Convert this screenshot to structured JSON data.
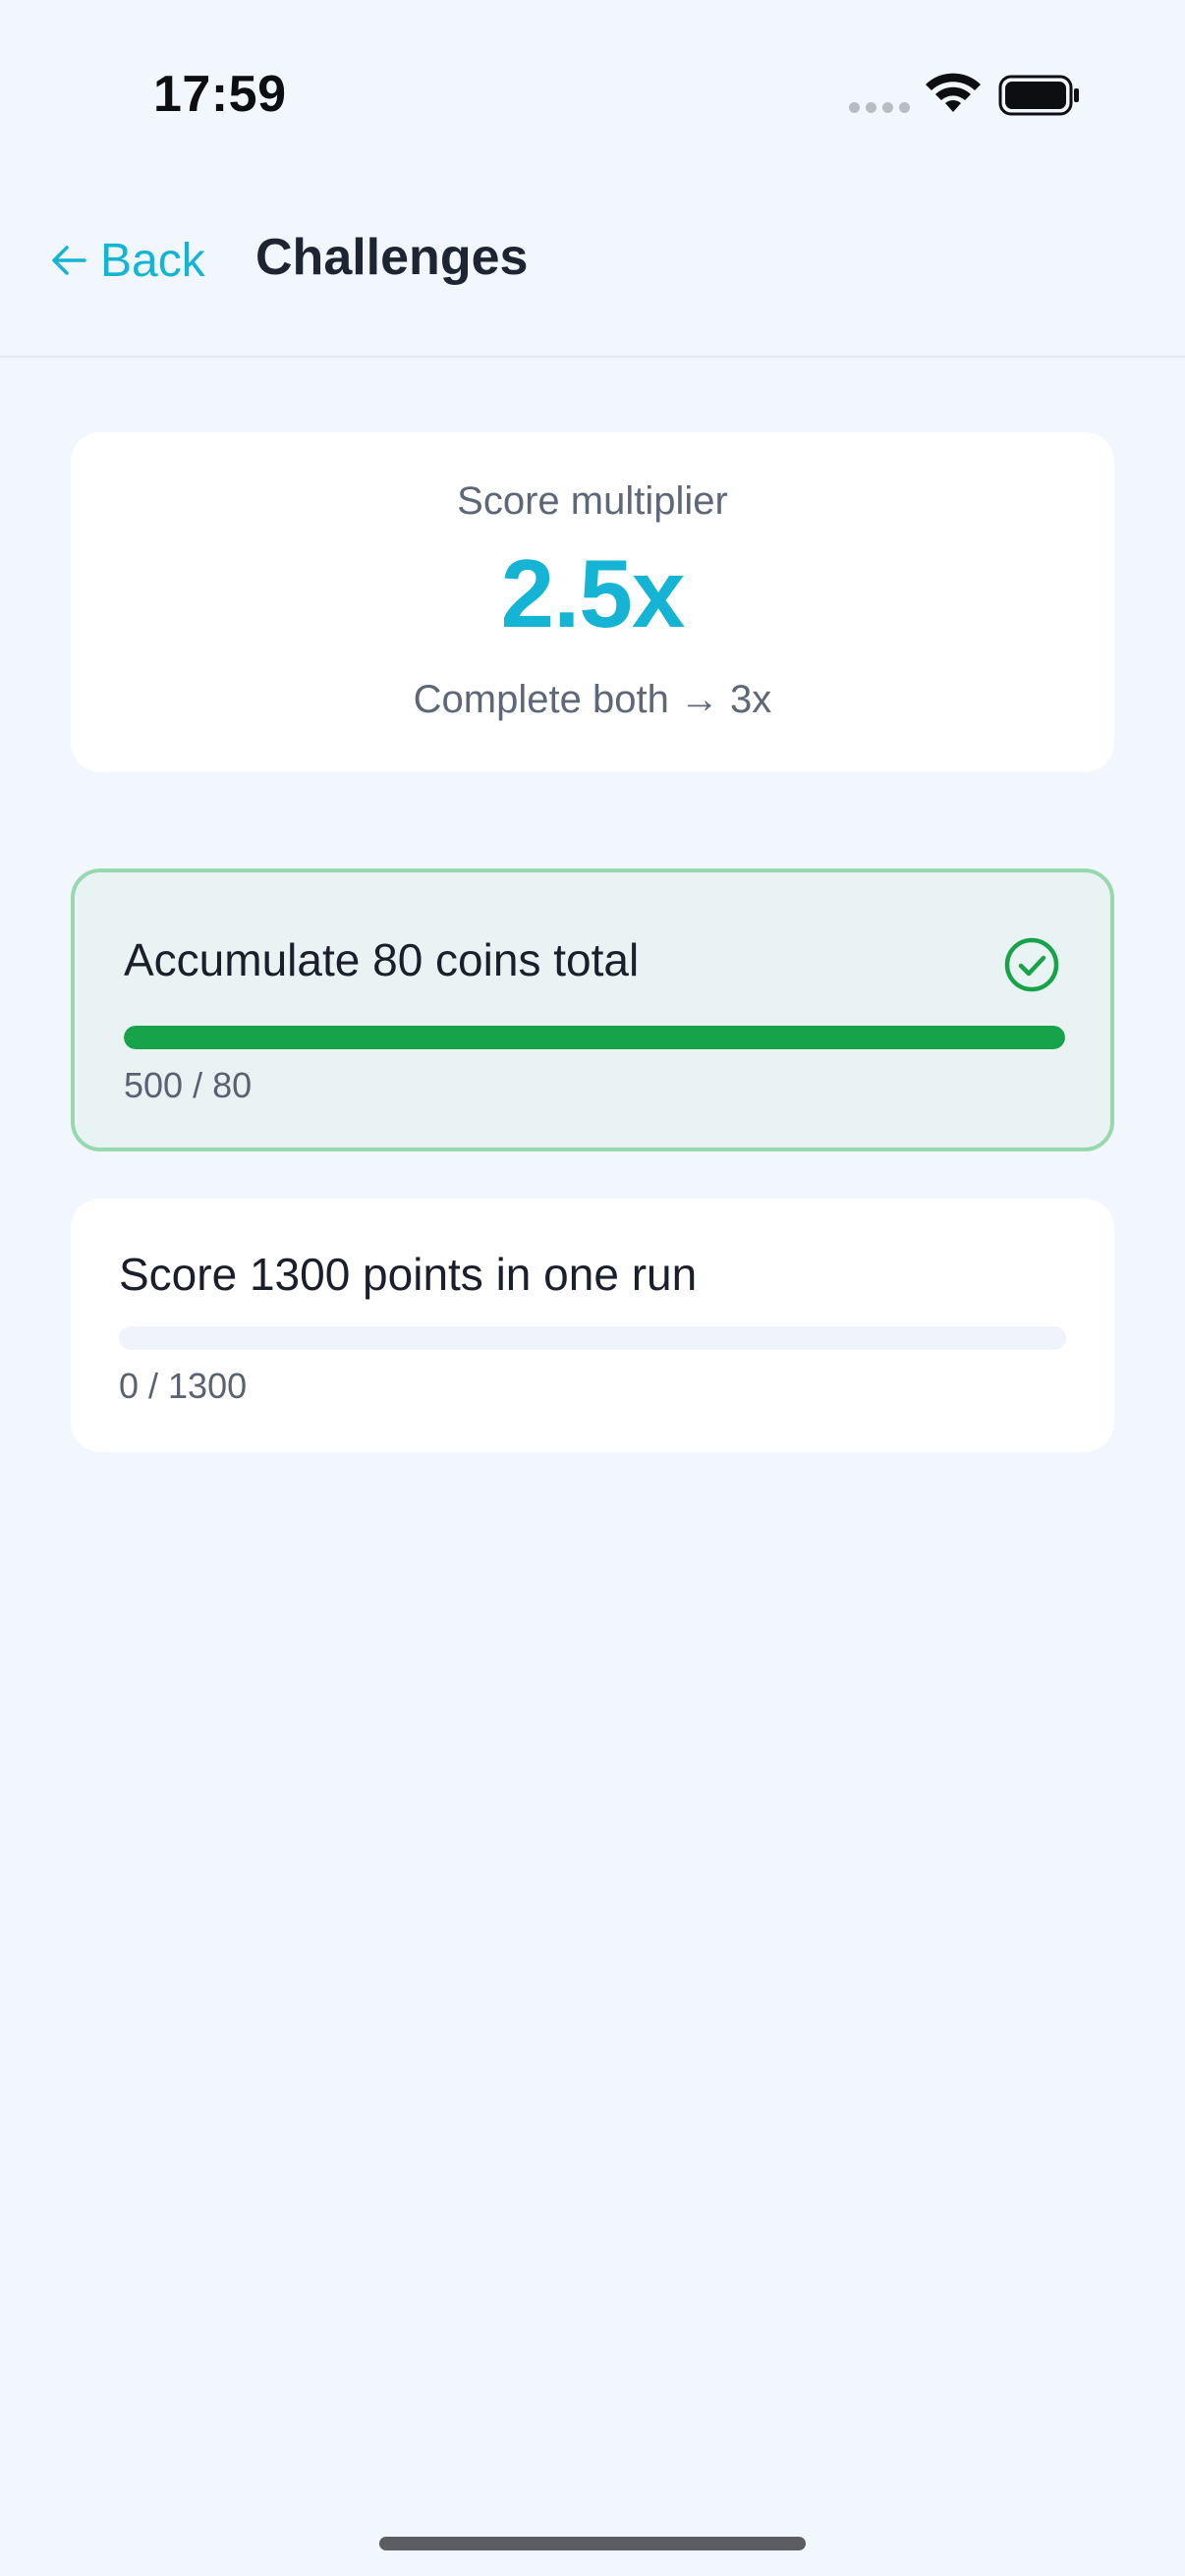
{
  "status_bar": {
    "time": "17:59",
    "icons": [
      "cellular-signal-icon",
      "wifi-icon",
      "battery-icon"
    ]
  },
  "nav": {
    "back_label": "Back",
    "title": "Challenges"
  },
  "multiplier": {
    "label": "Score multiplier",
    "value": "2.5x",
    "hint": "Complete both → 3x"
  },
  "challenges": [
    {
      "title": "Accumulate 80 coins total",
      "progress_text": "500 / 80",
      "progress_fraction": 1.0,
      "completed": true,
      "icon": "check-circle-icon"
    },
    {
      "title": "Score 1300 points in one run",
      "progress_text": "0 / 1300",
      "progress_fraction": 0.0,
      "completed": false
    }
  ],
  "colors": {
    "accent": "#13b5d2",
    "success": "#16a34a",
    "success_border": "#97d8ae",
    "background": "#f2f6fd"
  }
}
